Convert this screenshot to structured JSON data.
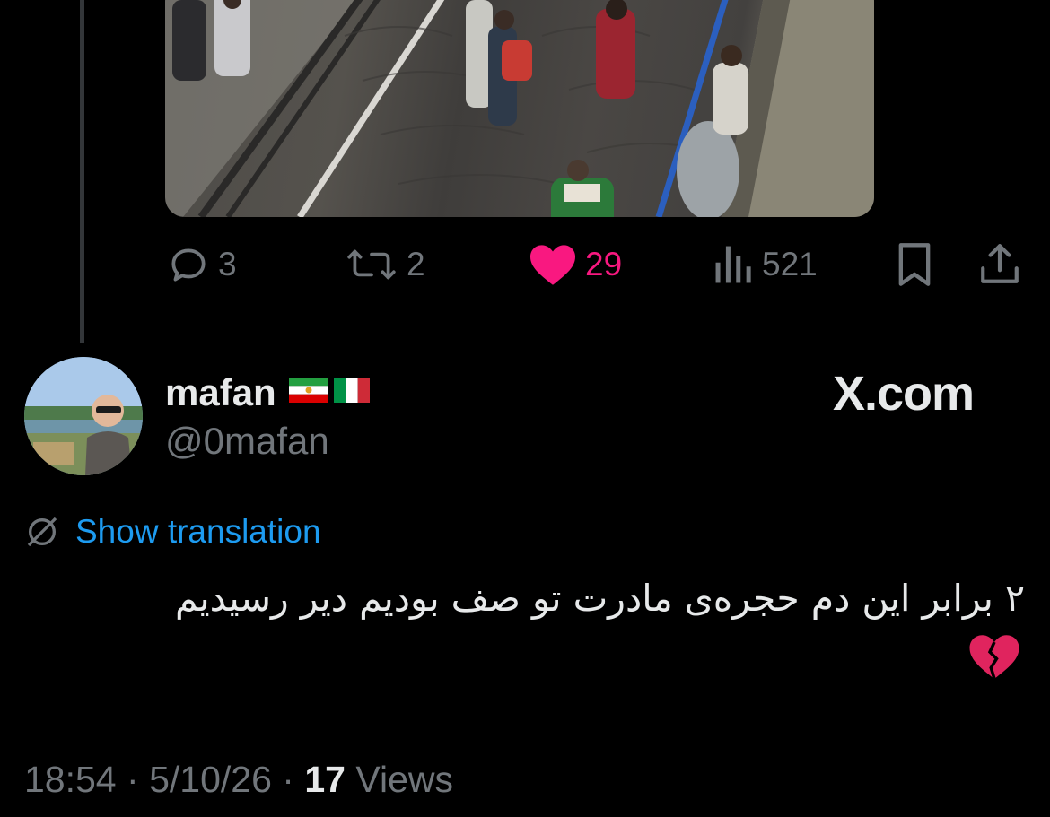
{
  "actions": {
    "replies": "3",
    "reposts": "2",
    "likes": "29",
    "views": "521"
  },
  "author": {
    "display_name": "mafan",
    "flags": [
      "iran-lion-sun-flag-icon",
      "italy-flag-icon"
    ],
    "handle": "@0mafan"
  },
  "watermark": "X.com",
  "translation_label": "Show translation",
  "tweet": {
    "text": "۲ برابر این دم حجره‌ی مادرت تو صف بودیم دیر رسیدیم",
    "emoji": "broken-heart-icon"
  },
  "meta": {
    "time": "18:54",
    "separator": "·",
    "date": "5/10/26",
    "view_count": "17",
    "views_label": "Views"
  },
  "colors": {
    "background": "#000000",
    "muted": "#71767b",
    "text": "#e7e9ea",
    "like": "#f91880",
    "link": "#1d9bf0"
  }
}
